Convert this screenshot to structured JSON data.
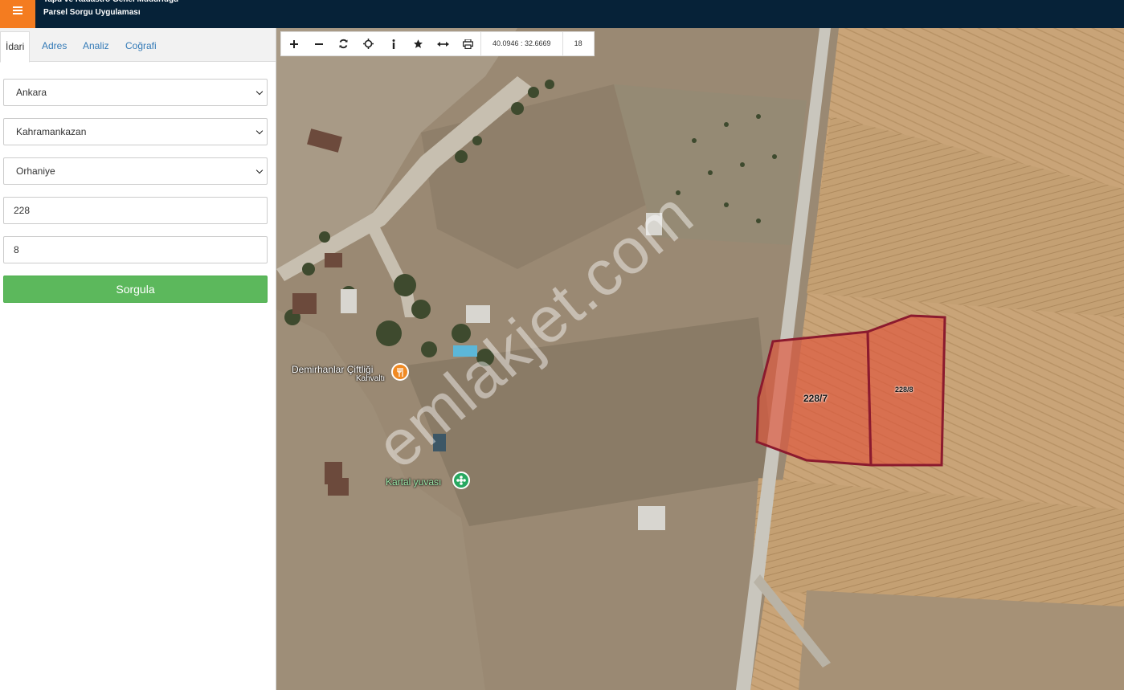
{
  "header": {
    "title_line1": "Tapu ve Kadastro Genel Müdürlüğü",
    "title_line2": "Parsel Sorgu Uygulaması",
    "menu_icon": "hamburger-icon",
    "bg_color": "#062238",
    "menu_color": "#f47c20"
  },
  "sidebar": {
    "tabs": [
      {
        "label": "İdari",
        "active": true
      },
      {
        "label": "Adres",
        "active": false
      },
      {
        "label": "Analiz",
        "active": false
      },
      {
        "label": "Coğrafi",
        "active": false
      }
    ],
    "il": "Ankara",
    "ilce": "Kahramankazan",
    "mahalle": "Orhaniye",
    "ada": "228",
    "parsel": "8",
    "submit_label": "Sorgula",
    "submit_color": "#5cb85c"
  },
  "map": {
    "toolbar": {
      "buttons": [
        "zoom-in-icon",
        "zoom-out-icon",
        "refresh-icon",
        "locate-icon",
        "info-icon",
        "favorite-icon",
        "measure-icon",
        "print-icon"
      ],
      "coordinates": "40.0946 : 32.6669",
      "zoom": "18"
    },
    "pois": [
      {
        "name": "Demirhanlar Çiftliği",
        "sub": "Kahvaltı",
        "icon": "restaurant-icon"
      },
      {
        "name": "Kartal yuvası",
        "icon": "park-icon"
      }
    ],
    "parcels": [
      {
        "label": "228/7"
      },
      {
        "label": "228/8"
      }
    ],
    "watermark": "emlakjet.com",
    "parcel_stroke": "#8b1a2e",
    "parcel_fill": "#e0543a"
  }
}
